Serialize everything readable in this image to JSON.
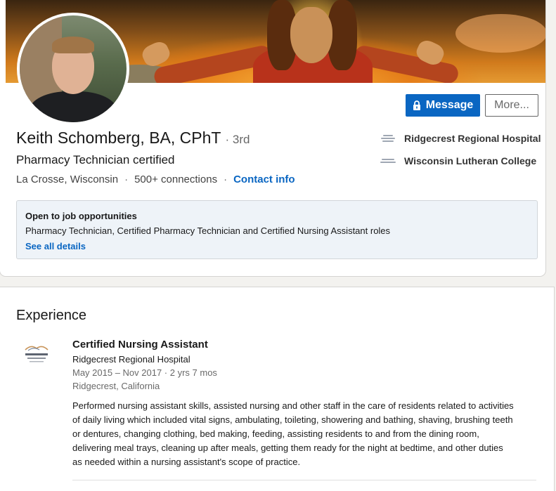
{
  "profile": {
    "name": "Keith Schomberg, BA, CPhT",
    "degree": "3rd",
    "headline": "Pharmacy Technician certified",
    "location": "La Crosse, Wisconsin",
    "connections": "500+ connections",
    "contact_label": "Contact info",
    "separator": "·"
  },
  "actions": {
    "message_label": "Message",
    "more_label": "More..."
  },
  "organizations": [
    {
      "name": "Ridgecrest Regional Hospital",
      "icon": "hospital-logo-icon"
    },
    {
      "name": "Wisconsin Lutheran College",
      "icon": "college-logo-icon"
    }
  ],
  "open_to_work": {
    "title": "Open to job opportunities",
    "roles": "Pharmacy Technician, Certified Pharmacy Technician and Certified Nursing Assistant roles",
    "link": "See all details"
  },
  "experience": {
    "section_title": "Experience",
    "items": [
      {
        "title": "Certified Nursing Assistant",
        "company": "Ridgecrest Regional Hospital",
        "dates": "May 2015 – Nov 2017 · 2 yrs 7 mos",
        "location": "Ridgecrest, California",
        "description": "Performed nursing assistant skills, assisted nursing and other staff in the care of residents related to activities of daily living which included vital signs, ambulating, toileting, showering and bathing, shaving, brushing teeth or dentures, changing clothing, bed making, feeding, assisting residents to and from the dining room, delivering meal trays, cleaning up after meals, getting them ready for the night at bedtime, and other duties as needed within a nursing assistant's scope of practice."
      }
    ]
  },
  "colors": {
    "accent": "#0a66c2",
    "background": "#f3f2ef",
    "open_box": "#eef3f8"
  }
}
